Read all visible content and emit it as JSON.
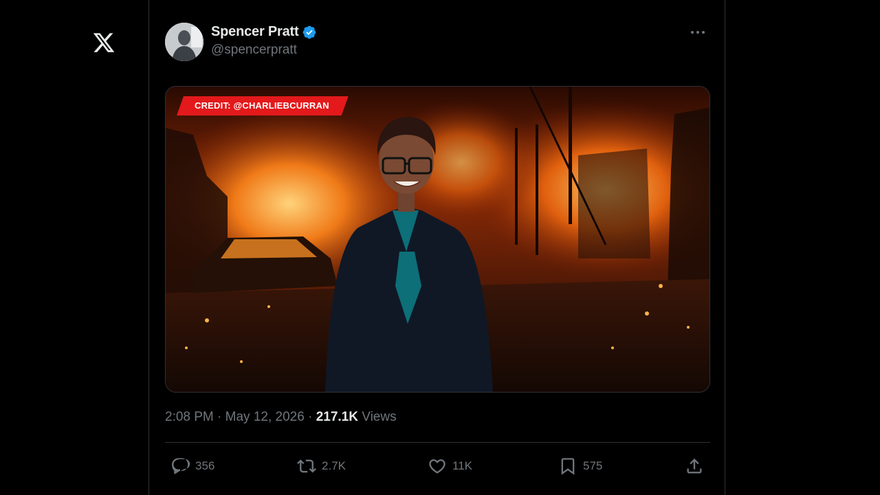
{
  "brand": {
    "logo_icon": "x-logo-icon"
  },
  "post": {
    "author": {
      "display_name": "Spencer Pratt",
      "handle": "@spencerpratt",
      "verified": true,
      "verified_color": "#1d9bf0"
    },
    "media": {
      "credit_label": "CREDIT: @CHARLIEBCURRAN",
      "credit_color": "#e3191b"
    },
    "meta": {
      "time": "2:08 PM",
      "separator": "·",
      "date": "May 12, 2026",
      "views_count": "217.1K",
      "views_label": "Views"
    },
    "actions": {
      "replies": "356",
      "reposts": "2.7K",
      "likes": "11K",
      "bookmarks": "575"
    }
  }
}
